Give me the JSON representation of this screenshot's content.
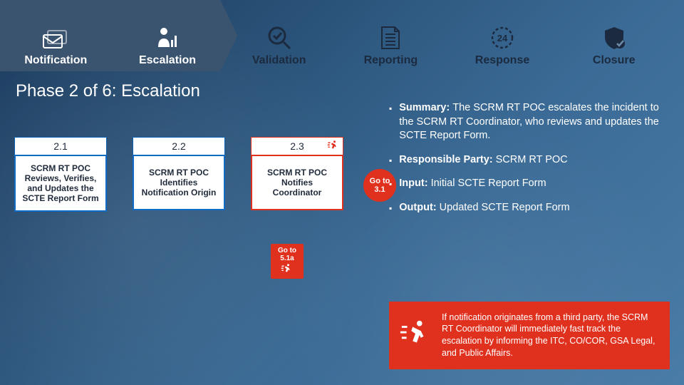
{
  "phases": [
    {
      "label": "Notification"
    },
    {
      "label": "Escalation"
    },
    {
      "label": "Validation"
    },
    {
      "label": "Reporting"
    },
    {
      "label": "Response"
    },
    {
      "label": "Closure"
    }
  ],
  "title": "Phase 2 of 6:  Escalation",
  "steps": [
    {
      "num": "2.1",
      "body": "SCRM RT POC Reviews, Verifies, and Updates the SCTE Report Form",
      "fast": false
    },
    {
      "num": "2.2",
      "body": "SCRM RT POC Identifies Notification Origin",
      "fast": false
    },
    {
      "num": "2.3",
      "body": "SCRM RT POC Notifies Coordinator",
      "fast": true
    }
  ],
  "goto31": "Go to 3.1",
  "goto51a": "Go to 5.1a",
  "bullets": {
    "summary_label": "Summary:",
    "summary_text": "The SCRM RT POC escalates the incident to the SCRM RT Coordinator, who reviews and updates the SCTE Report Form.",
    "resp_label": "Responsible Party:",
    "resp_text": "SCRM RT POC",
    "input_label": "Input:",
    "input_text": "Initial SCTE Report Form",
    "output_label": "Output:",
    "output_text": "Updated SCTE Report Form"
  },
  "fast_note": "If notification originates from a third party, the SCRM RT  Coordinator will immediately fast track the escalation by informing the ITC, CO/COR, GSA Legal, and Public Affairs."
}
